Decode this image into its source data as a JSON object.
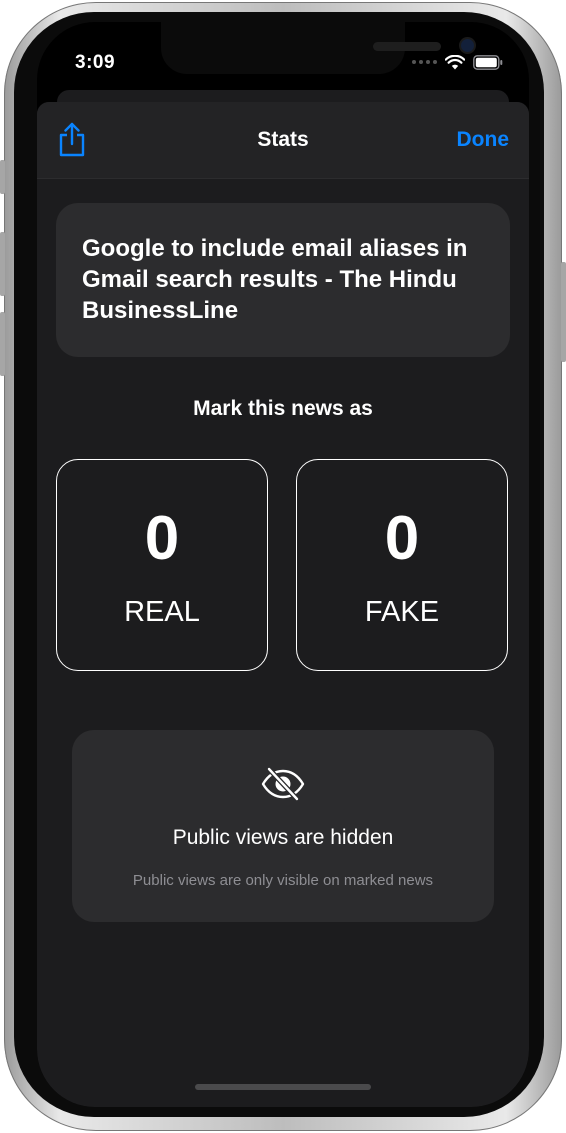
{
  "status_bar": {
    "time": "3:09"
  },
  "nav": {
    "title": "Stats",
    "done_label": "Done",
    "share_icon": "share-icon"
  },
  "headline": {
    "text": "Google to include email aliases in Gmail search results - The Hindu BusinessLine"
  },
  "prompt": {
    "label": "Mark this news as"
  },
  "votes": {
    "real": {
      "count": "0",
      "label": "REAL"
    },
    "fake": {
      "count": "0",
      "label": "FAKE"
    }
  },
  "views": {
    "icon": "eye-slash-icon",
    "title": "Public views are hidden",
    "subtitle": "Public views are only visible on marked news"
  },
  "colors": {
    "accent": "#0a84ff",
    "background": "#1c1c1e",
    "card": "#2c2c2e"
  }
}
